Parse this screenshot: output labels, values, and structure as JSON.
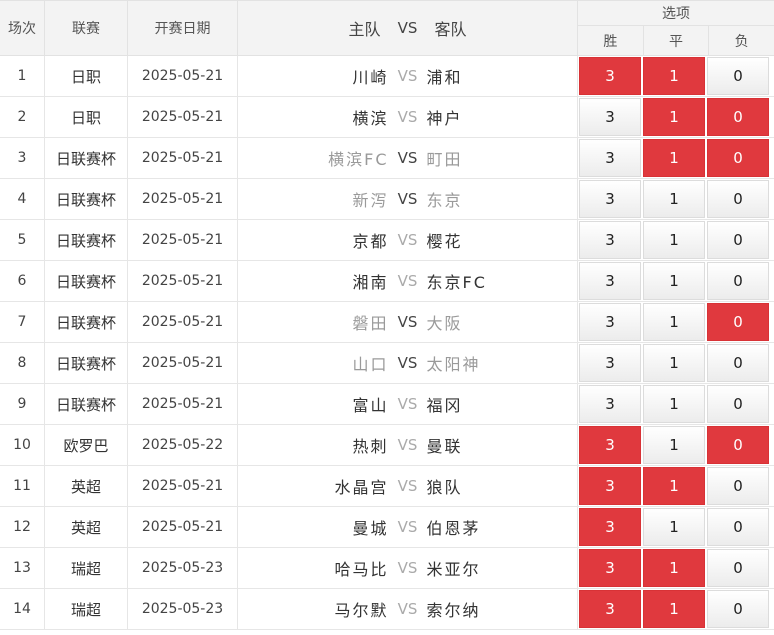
{
  "header": {
    "no": "场次",
    "league": "联赛",
    "date": "开赛日期",
    "home": "主队",
    "vs": "VS",
    "away": "客队",
    "options": "选项",
    "win": "胜",
    "draw": "平",
    "loss": "负"
  },
  "rows": [
    {
      "no": "1",
      "league": "日职",
      "date": "2025-05-21",
      "home": "川崎",
      "vs": "VS",
      "away": "浦和",
      "w": "3",
      "d": "1",
      "l": "0",
      "muted": false,
      "sel": [
        true,
        true,
        false
      ]
    },
    {
      "no": "2",
      "league": "日职",
      "date": "2025-05-21",
      "home": "横滨",
      "vs": "VS",
      "away": "神户",
      "w": "3",
      "d": "1",
      "l": "0",
      "muted": false,
      "sel": [
        false,
        true,
        true
      ]
    },
    {
      "no": "3",
      "league": "日联赛杯",
      "date": "2025-05-21",
      "home": "横滨FC",
      "vs": "VS",
      "away": "町田",
      "w": "3",
      "d": "1",
      "l": "0",
      "muted": true,
      "sel": [
        false,
        true,
        true
      ]
    },
    {
      "no": "4",
      "league": "日联赛杯",
      "date": "2025-05-21",
      "home": "新泻",
      "vs": "VS",
      "away": "东京",
      "w": "3",
      "d": "1",
      "l": "0",
      "muted": true,
      "sel": [
        false,
        false,
        false
      ]
    },
    {
      "no": "5",
      "league": "日联赛杯",
      "date": "2025-05-21",
      "home": "京都",
      "vs": "VS",
      "away": "樱花",
      "w": "3",
      "d": "1",
      "l": "0",
      "muted": false,
      "sel": [
        false,
        false,
        false
      ]
    },
    {
      "no": "6",
      "league": "日联赛杯",
      "date": "2025-05-21",
      "home": "湘南",
      "vs": "VS",
      "away": "东京FC",
      "w": "3",
      "d": "1",
      "l": "0",
      "muted": false,
      "sel": [
        false,
        false,
        false
      ]
    },
    {
      "no": "7",
      "league": "日联赛杯",
      "date": "2025-05-21",
      "home": "磐田",
      "vs": "VS",
      "away": "大阪",
      "w": "3",
      "d": "1",
      "l": "0",
      "muted": true,
      "sel": [
        false,
        false,
        true
      ]
    },
    {
      "no": "8",
      "league": "日联赛杯",
      "date": "2025-05-21",
      "home": "山口",
      "vs": "VS",
      "away": "太阳神",
      "w": "3",
      "d": "1",
      "l": "0",
      "muted": true,
      "sel": [
        false,
        false,
        false
      ]
    },
    {
      "no": "9",
      "league": "日联赛杯",
      "date": "2025-05-21",
      "home": "富山",
      "vs": "VS",
      "away": "福冈",
      "w": "3",
      "d": "1",
      "l": "0",
      "muted": false,
      "sel": [
        false,
        false,
        false
      ]
    },
    {
      "no": "10",
      "league": "欧罗巴",
      "date": "2025-05-22",
      "home": "热刺",
      "vs": "VS",
      "away": "曼联",
      "w": "3",
      "d": "1",
      "l": "0",
      "muted": false,
      "sel": [
        true,
        false,
        true
      ]
    },
    {
      "no": "11",
      "league": "英超",
      "date": "2025-05-21",
      "home": "水晶宫",
      "vs": "VS",
      "away": "狼队",
      "w": "3",
      "d": "1",
      "l": "0",
      "muted": false,
      "sel": [
        true,
        true,
        false
      ]
    },
    {
      "no": "12",
      "league": "英超",
      "date": "2025-05-21",
      "home": "曼城",
      "vs": "VS",
      "away": "伯恩茅",
      "w": "3",
      "d": "1",
      "l": "0",
      "muted": false,
      "sel": [
        true,
        false,
        false
      ]
    },
    {
      "no": "13",
      "league": "瑞超",
      "date": "2025-05-23",
      "home": "哈马比",
      "vs": "VS",
      "away": "米亚尔",
      "w": "3",
      "d": "1",
      "l": "0",
      "muted": false,
      "sel": [
        true,
        true,
        false
      ]
    },
    {
      "no": "14",
      "league": "瑞超",
      "date": "2025-05-23",
      "home": "马尔默",
      "vs": "VS",
      "away": "索尔纳",
      "w": "3",
      "d": "1",
      "l": "0",
      "muted": false,
      "sel": [
        true,
        true,
        false
      ]
    }
  ],
  "colors": {
    "selected": "#e0393e",
    "header_bg": "#f3f3f3"
  }
}
